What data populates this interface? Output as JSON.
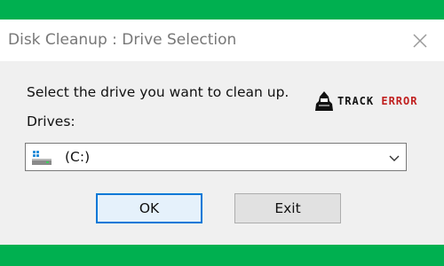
{
  "window": {
    "title": "Disk Cleanup : Drive Selection"
  },
  "dialog": {
    "prompt": "Select the drive you want to clean up.",
    "drives_label": "Drives:",
    "drive_selected": "(C:)",
    "ok_label": "OK",
    "exit_label": "Exit"
  },
  "watermark": {
    "text_part1": "TRACK",
    "text_part2": "ERROR"
  },
  "colors": {
    "frame_green": "#00b050",
    "focus_border": "#0078d7",
    "logo_red": "#c0201f"
  },
  "icons": {
    "close": "close-icon",
    "drive": "hard-drive-icon",
    "dropdown": "chevron-down-icon",
    "logo": "hacker-logo-icon"
  }
}
